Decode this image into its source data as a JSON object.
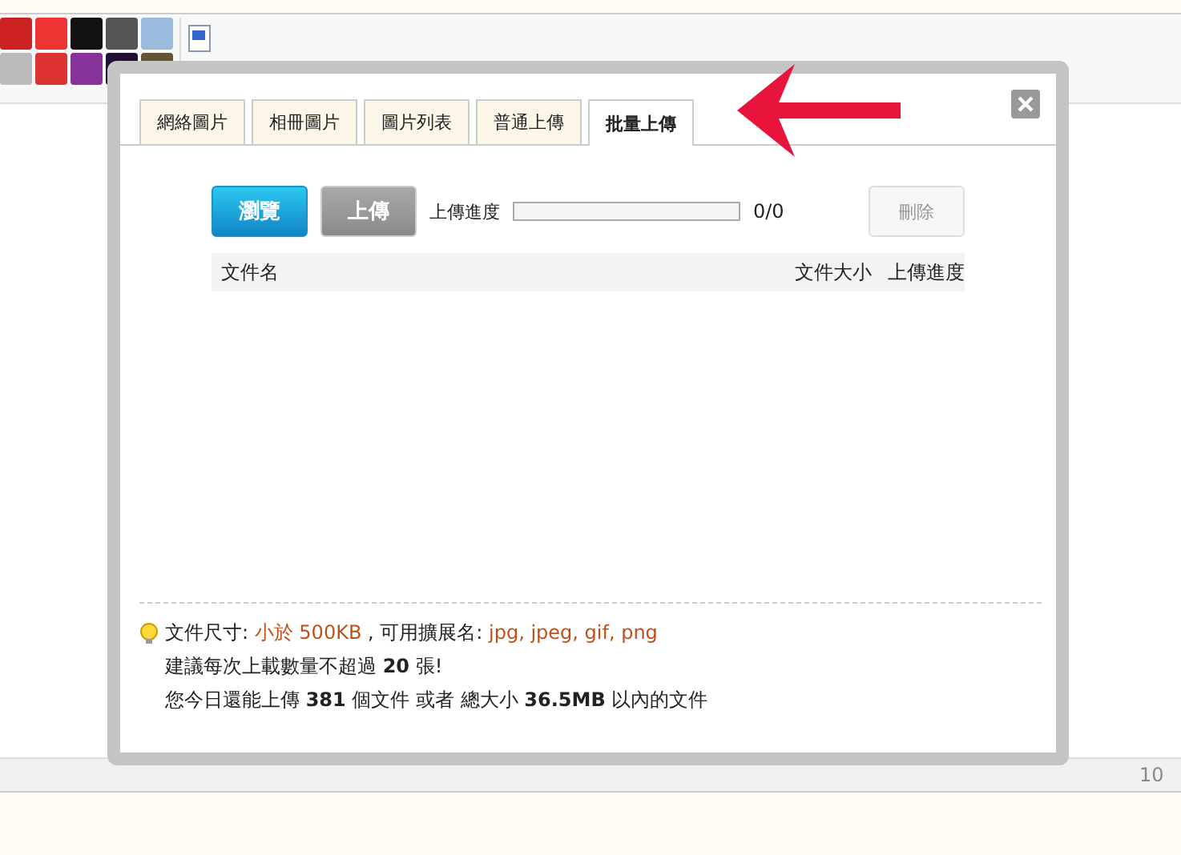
{
  "dialog": {
    "tabs": [
      {
        "label": "網絡圖片",
        "selected": false
      },
      {
        "label": "相冊圖片",
        "selected": false
      },
      {
        "label": "圖片列表",
        "selected": false
      },
      {
        "label": "普通上傳",
        "selected": false
      },
      {
        "label": "批量上傳",
        "selected": true
      }
    ],
    "browse_button": {
      "label": "瀏覽",
      "disabled": false
    },
    "upload_button": {
      "label": "上傳",
      "disabled": true
    },
    "progress": {
      "label": "上傳進度",
      "level": 0,
      "reading": "0/0"
    },
    "delete_button": {
      "label": "刪除",
      "disabled": true
    },
    "table": {
      "columns": [
        "文件名",
        "文件大小",
        "上傳進度"
      ]
    },
    "notes": [
      [
        {
          "kind": "plain",
          "text": "文件尺寸: "
        },
        {
          "kind": "accent",
          "text": "小於 500KB"
        },
        {
          "kind": "plain",
          "text": " , 可用擴展名: "
        },
        {
          "kind": "accent",
          "text": "jpg, jpeg, gif, png"
        }
      ],
      [
        {
          "kind": "plain",
          "text": "建議每次上載數量不超過 "
        },
        {
          "kind": "bold",
          "text": "20"
        },
        {
          "kind": "plain",
          "text": " 張!"
        }
      ],
      [
        {
          "kind": "plain",
          "text": "您今日還能上傳 "
        },
        {
          "kind": "bold",
          "text": "381"
        },
        {
          "kind": "plain",
          "text": " 個文件 或者 總大小 "
        },
        {
          "kind": "bold",
          "text": "36.5MB"
        },
        {
          "kind": "plain",
          "text": " 以內的文件"
        }
      ]
    ]
  },
  "status_bar": {
    "text": "10"
  }
}
